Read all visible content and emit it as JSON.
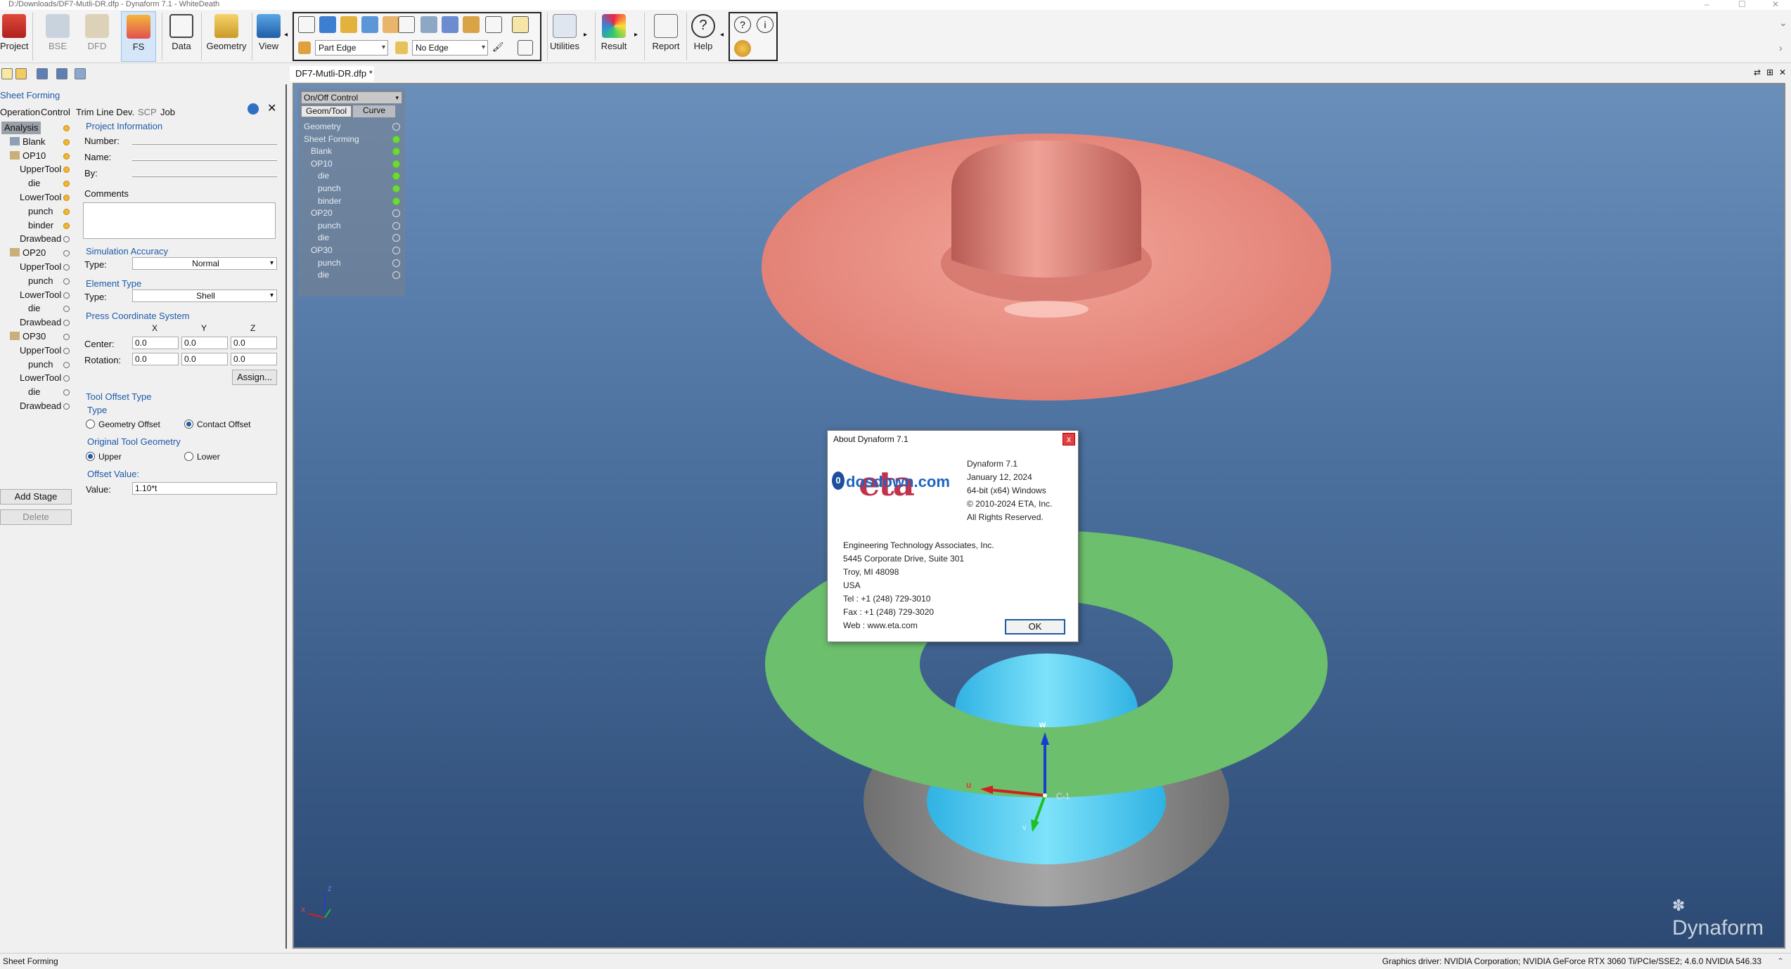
{
  "window": {
    "title": "D:/Downloads/DF7-Mutli-DR.dfp - Dynaform 7.1 - WhiteDeath"
  },
  "ribbon": {
    "buttons": [
      "Project",
      "BSE",
      "DFD",
      "FS",
      "Data",
      "Geometry",
      "View",
      "Utilities",
      "Result",
      "Report",
      "Help"
    ],
    "part_edge": "Part Edge",
    "no_edge": "No Edge"
  },
  "panel": {
    "title": "Sheet Forming",
    "tabs": [
      "Operation",
      "Control",
      "Trim Line Dev.",
      "SCP",
      "Job"
    ],
    "tree": [
      {
        "label": "Analysis",
        "indent": 0
      },
      {
        "label": "Blank",
        "indent": 1
      },
      {
        "label": "OP10",
        "indent": 1
      },
      {
        "label": "UpperTool",
        "indent": 2
      },
      {
        "label": "die",
        "indent": 3
      },
      {
        "label": "LowerTool",
        "indent": 2
      },
      {
        "label": "punch",
        "indent": 3
      },
      {
        "label": "binder",
        "indent": 3
      },
      {
        "label": "Drawbead",
        "indent": 2
      },
      {
        "label": "OP20",
        "indent": 1
      },
      {
        "label": "UpperTool",
        "indent": 2
      },
      {
        "label": "punch",
        "indent": 3
      },
      {
        "label": "LowerTool",
        "indent": 2
      },
      {
        "label": "die",
        "indent": 3
      },
      {
        "label": "Drawbead",
        "indent": 2
      },
      {
        "label": "OP30",
        "indent": 1
      },
      {
        "label": "UpperTool",
        "indent": 2
      },
      {
        "label": "punch",
        "indent": 3
      },
      {
        "label": "LowerTool",
        "indent": 2
      },
      {
        "label": "die",
        "indent": 3
      },
      {
        "label": "Drawbead",
        "indent": 2
      }
    ],
    "project_info": {
      "title": "Project Information",
      "number": "Number:",
      "name": "Name:",
      "by": "By:",
      "comments": "Comments"
    },
    "sim_accuracy": {
      "title": "Simulation Accuracy",
      "type_label": "Type:",
      "value": "Normal"
    },
    "element_type": {
      "title": "Element Type",
      "type_label": "Type:",
      "value": "Shell"
    },
    "press_coord": {
      "title": "Press Coordinate System",
      "x": "X",
      "y": "Y",
      "z": "Z",
      "center_label": "Center:",
      "center": [
        "0.0",
        "0.0",
        "0.0"
      ],
      "rotation_label": "Rotation:",
      "rotation": [
        "0.0",
        "0.0",
        "0.0"
      ],
      "assign": "Assign..."
    },
    "tool_offset": {
      "title": "Tool Offset Type",
      "type": "Type",
      "geometry_offset": "Geometry Offset",
      "contact_offset": "Contact Offset",
      "original_title": "Original Tool Geometry",
      "upper": "Upper",
      "lower": "Lower",
      "offset_title": "Offset Value:",
      "value_label": "Value:",
      "value": "1.10*t"
    },
    "add_stage": "Add Stage",
    "delete": "Delete"
  },
  "document": {
    "tab": "DF7-Mutli-DR.dfp *"
  },
  "onoff": {
    "title": "On/Off Control",
    "tabs": [
      "Geom/Tool",
      "Curve"
    ],
    "items": [
      {
        "label": "Geometry",
        "indent": 0,
        "on": false
      },
      {
        "label": "Sheet Forming",
        "indent": 0,
        "on": true
      },
      {
        "label": "Blank",
        "indent": 1,
        "on": true
      },
      {
        "label": "OP10",
        "indent": 1,
        "on": true
      },
      {
        "label": "die",
        "indent": 2,
        "on": true
      },
      {
        "label": "punch",
        "indent": 2,
        "on": true
      },
      {
        "label": "binder",
        "indent": 2,
        "on": true
      },
      {
        "label": "OP20",
        "indent": 1,
        "on": false
      },
      {
        "label": "punch",
        "indent": 2,
        "on": false
      },
      {
        "label": "die",
        "indent": 2,
        "on": false
      },
      {
        "label": "OP30",
        "indent": 1,
        "on": false
      },
      {
        "label": "punch",
        "indent": 2,
        "on": false
      },
      {
        "label": "die",
        "indent": 2,
        "on": false
      }
    ]
  },
  "triad": {
    "w": "w",
    "u": "u",
    "v": "v",
    "c": "C-1"
  },
  "mini_triad": {
    "z": "Z",
    "x": "X"
  },
  "brand": {
    "watermark": "Dynaform"
  },
  "about": {
    "title": "About Dynaform 7.1",
    "close": "x",
    "logo_text": "dosdown.com",
    "logo_badge": "0",
    "logo_brand": "eta",
    "version": "Dynaform 7.1",
    "date": "January 12, 2024",
    "platform": "64-bit (x64) Windows",
    "copyright": "© 2010-2024  ETA, Inc.",
    "rights": "All Rights Reserved.",
    "company": "Engineering Technology Associates, Inc.",
    "address1": "5445 Corporate Drive, Suite 301",
    "address2": "Troy, MI 48098",
    "country": "USA",
    "tel": "Tel : +1 (248) 729-3010",
    "fax": "Fax : +1 (248) 729-3020",
    "web": "Web : www.eta.com",
    "ok": "OK"
  },
  "status": {
    "left": "Sheet Forming",
    "right": "Graphics driver: NVIDIA Corporation; NVIDIA GeForce RTX 3060 Ti/PCIe/SSE2; 4.6.0 NVIDIA 546.33"
  },
  "colors": {
    "accent": "#1e5aa8",
    "blank": "#e8877d",
    "binder": "#6cbf6c",
    "punch": "#45c8ea",
    "die": "#8a8a8a"
  }
}
